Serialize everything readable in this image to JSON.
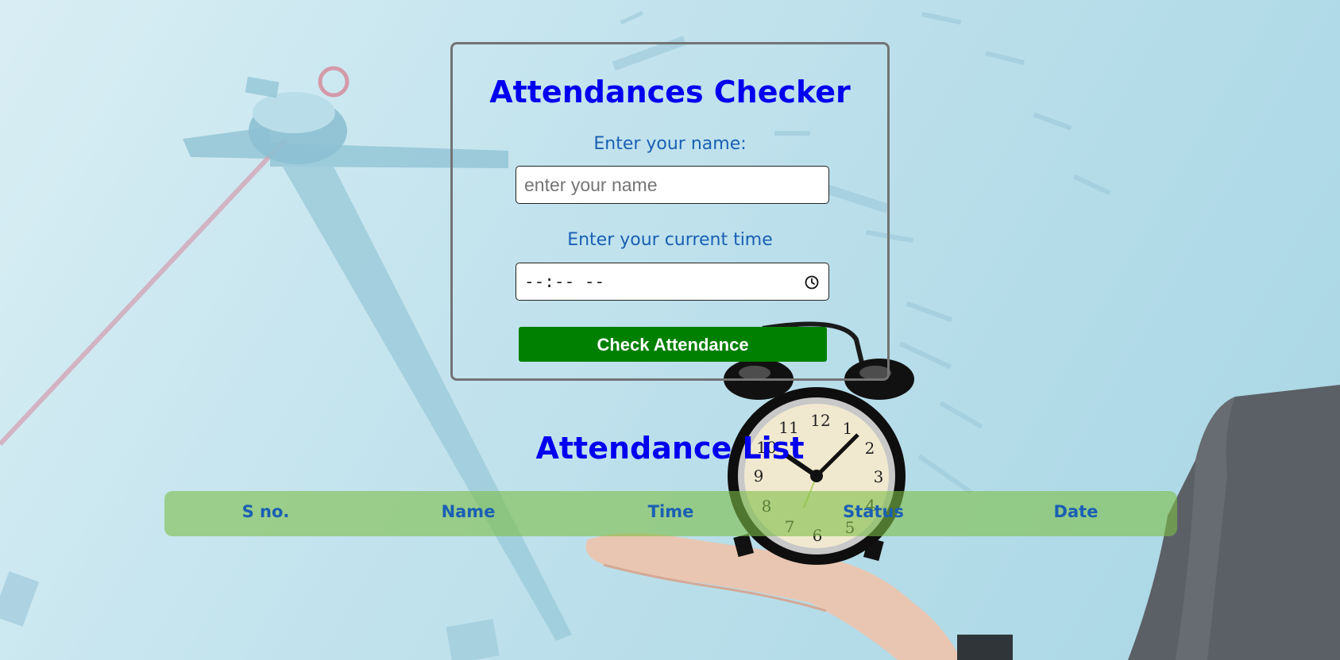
{
  "form": {
    "title": "Attendances Checker",
    "name_label": "Enter your name:",
    "name_placeholder": "enter your name",
    "name_value": "",
    "time_label": "Enter your current time",
    "time_display": "--:-- --",
    "submit_label": "Check Attendance"
  },
  "list": {
    "title": "Attendance List",
    "columns": [
      "S no.",
      "Name",
      "Time",
      "Status",
      "Date"
    ]
  },
  "colors": {
    "heading": "#0000ee",
    "label": "#1a5fb4",
    "button": "#008000",
    "table_header": "#9cc884"
  },
  "icons": {
    "time_field": "clock-icon"
  }
}
